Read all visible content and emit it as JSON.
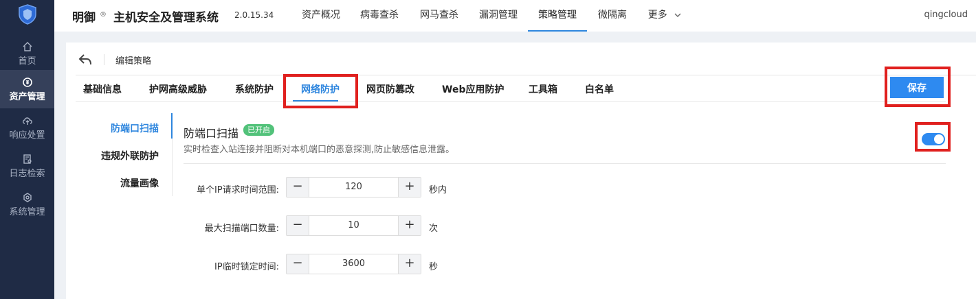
{
  "sidebar": {
    "items": [
      {
        "label": "首页",
        "icon": "home-icon"
      },
      {
        "label": "资产管理",
        "icon": "asset-icon",
        "active": true
      },
      {
        "label": "响应处置",
        "icon": "cloud-upload-icon"
      },
      {
        "label": "日志检索",
        "icon": "log-search-icon"
      },
      {
        "label": "系统管理",
        "icon": "settings-icon"
      }
    ]
  },
  "header": {
    "brand": "明御",
    "registered": "®",
    "system_name": "主机安全及管理系统",
    "version": "2.0.15.34",
    "nav": [
      "资产概况",
      "病毒查杀",
      "网马查杀",
      "漏洞管理",
      "策略管理",
      "微隔离",
      "更多"
    ],
    "active_nav": "策略管理",
    "user": "qingcloud"
  },
  "page": {
    "breadcrumb": "编辑策略",
    "tabs": [
      "基础信息",
      "护网高级威胁",
      "系统防护",
      "网络防护",
      "网页防篡改",
      "Web应用防护",
      "工具箱",
      "白名单"
    ],
    "active_tab": "网络防护",
    "save_label": "保存",
    "subnav": [
      "防端口扫描",
      "违规外联防护",
      "流量画像"
    ],
    "active_subnav": "防端口扫描",
    "section": {
      "title": "防端口扫描",
      "badge": "已开启",
      "description": "实时检查入站连接并阻断对本机端口的恶意探测,防止敏感信息泄露。",
      "enabled": true
    },
    "fields": [
      {
        "label": "单个IP请求时间范围:",
        "value": "120",
        "unit": "秒内"
      },
      {
        "label": "最大扫描端口数量:",
        "value": "10",
        "unit": "次"
      },
      {
        "label": "IP临时锁定时间:",
        "value": "3600",
        "unit": "秒"
      }
    ],
    "stepper_minus": "−",
    "stepper_plus": "+"
  },
  "colors": {
    "accent": "#2e8af0",
    "sidebar_bg": "#1f2b45",
    "badge_green": "#52c27a",
    "highlight_red": "#e0201e"
  }
}
